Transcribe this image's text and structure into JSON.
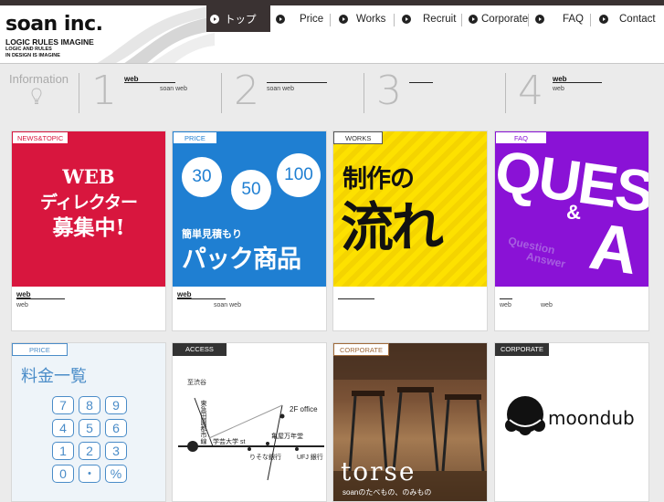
{
  "header": {
    "logo_main": "soan inc.",
    "logo_sub": "LOGIC RULES IMAGINE",
    "logo_sub2_line1": "LOGIC AND RULES",
    "logo_sub2_line2": "IN DESIGN IS IMAGINE"
  },
  "nav": [
    {
      "label": "トップ",
      "active": true
    },
    {
      "label": "Price"
    },
    {
      "label": "Works"
    },
    {
      "label": "Recruit"
    },
    {
      "label": "Corporate"
    },
    {
      "label": "FAQ"
    },
    {
      "label": "Contact"
    }
  ],
  "info": {
    "label": "Information",
    "items": [
      {
        "num": "1",
        "title": "web",
        "sub": "soan web"
      },
      {
        "num": "2",
        "title": "",
        "sub": "soan web"
      },
      {
        "num": "3",
        "title": "",
        "sub": ""
      },
      {
        "num": "4",
        "title": "web",
        "sub": "web"
      }
    ]
  },
  "cards": [
    {
      "tag": "NEWS&TOPIC",
      "title": "web",
      "sub": "web",
      "sub2": "",
      "img_lines": [
        "WEB",
        "ディレクター",
        "募集中!"
      ]
    },
    {
      "tag": "PRICE",
      "title": "web",
      "sub": "",
      "sub2": "soan web",
      "img_nums": [
        "30",
        "50",
        "100"
      ],
      "img_small": "簡単見積もり",
      "img_big": "パック商品"
    },
    {
      "tag": "WORKS",
      "title": "",
      "sub": "",
      "sub2": "",
      "img_lines": [
        "制作の",
        "流れ"
      ]
    },
    {
      "tag": "FAQ",
      "title": "",
      "sub": "web",
      "sub2": "web",
      "img_big": "QUES",
      "img_amp": "&",
      "img_a": "A",
      "img_small1": "Question",
      "img_small2": "Answer"
    },
    {
      "tag": "PRICE",
      "img_title": "料金一覧",
      "keys": [
        "7",
        "8",
        "9",
        "4",
        "5",
        "6",
        "1",
        "2",
        "3",
        "0",
        "・",
        "%"
      ]
    },
    {
      "tag": "ACCESS",
      "map_labels": [
        "至渋谷",
        "東急田園都市線",
        "2F office",
        "学芸大学 st",
        "亀屋万年堂",
        "りそな銀行",
        "UFJ 銀行"
      ]
    },
    {
      "tag": "CORPORATE",
      "img_big": "torse",
      "img_small": "soanのたべもの、のみもの"
    },
    {
      "tag": "CORPORATE",
      "img_big": "moondub"
    }
  ]
}
